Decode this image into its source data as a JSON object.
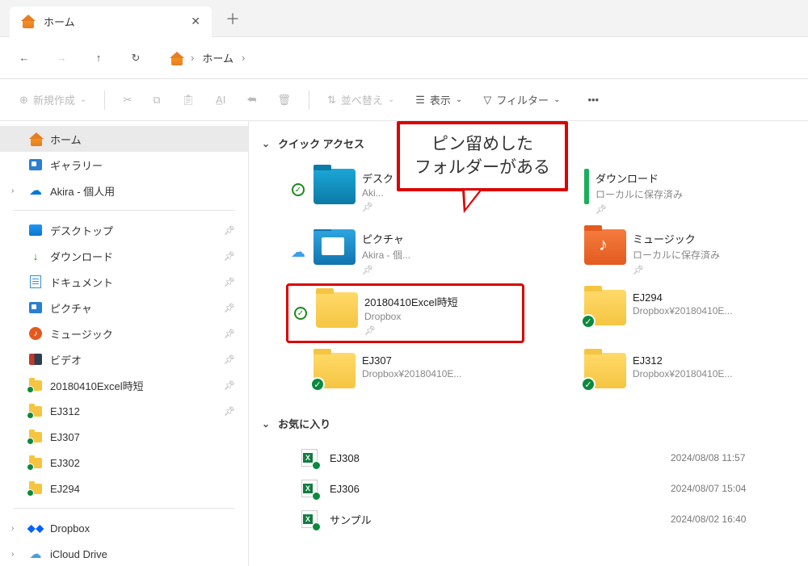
{
  "tab": {
    "title": "ホーム"
  },
  "breadcrumb": {
    "home": "ホーム"
  },
  "toolbar": {
    "new": "新規作成",
    "sort": "並べ替え",
    "view": "表示",
    "filter": "フィルター"
  },
  "sidebar": {
    "home": "ホーム",
    "gallery": "ギャラリー",
    "personal": "Akira - 個人用",
    "desktop": "デスクトップ",
    "downloads": "ダウンロード",
    "documents": "ドキュメント",
    "pictures": "ピクチャ",
    "music": "ミュージック",
    "videos": "ビデオ",
    "f1": "20180410Excel時短",
    "f2": "EJ312",
    "f3": "EJ307",
    "f4": "EJ302",
    "f5": "EJ294",
    "dropbox": "Dropbox",
    "icloud": "iCloud Drive"
  },
  "sections": {
    "quickAccess": "クイック アクセス",
    "favorites": "お気に入り"
  },
  "quickAccess": [
    {
      "name": "デスクトップ",
      "sub": "Akira - 個人用"
    },
    {
      "name": "ダウンロード",
      "sub": "ローカルに保存済み"
    },
    {
      "name": "ピクチャ",
      "sub": "Akira - 個人用"
    },
    {
      "name": "ミュージック",
      "sub": "ローカルに保存済み"
    },
    {
      "name": "20180410Excel時短",
      "sub": "Dropbox"
    },
    {
      "name": "EJ294",
      "sub": "Dropbox¥20180410E..."
    },
    {
      "name": "EJ307",
      "sub": "Dropbox¥20180410E..."
    },
    {
      "name": "EJ312",
      "sub": "Dropbox¥20180410E..."
    }
  ],
  "favorites": [
    {
      "name": "EJ308",
      "date": "2024/08/08 11:57"
    },
    {
      "name": "EJ306",
      "date": "2024/08/07 15:04"
    },
    {
      "name": "サンプル",
      "date": "2024/08/02 16:40"
    }
  ],
  "callout": {
    "line1": "ピン留めした",
    "line2": "フォルダーがある"
  }
}
